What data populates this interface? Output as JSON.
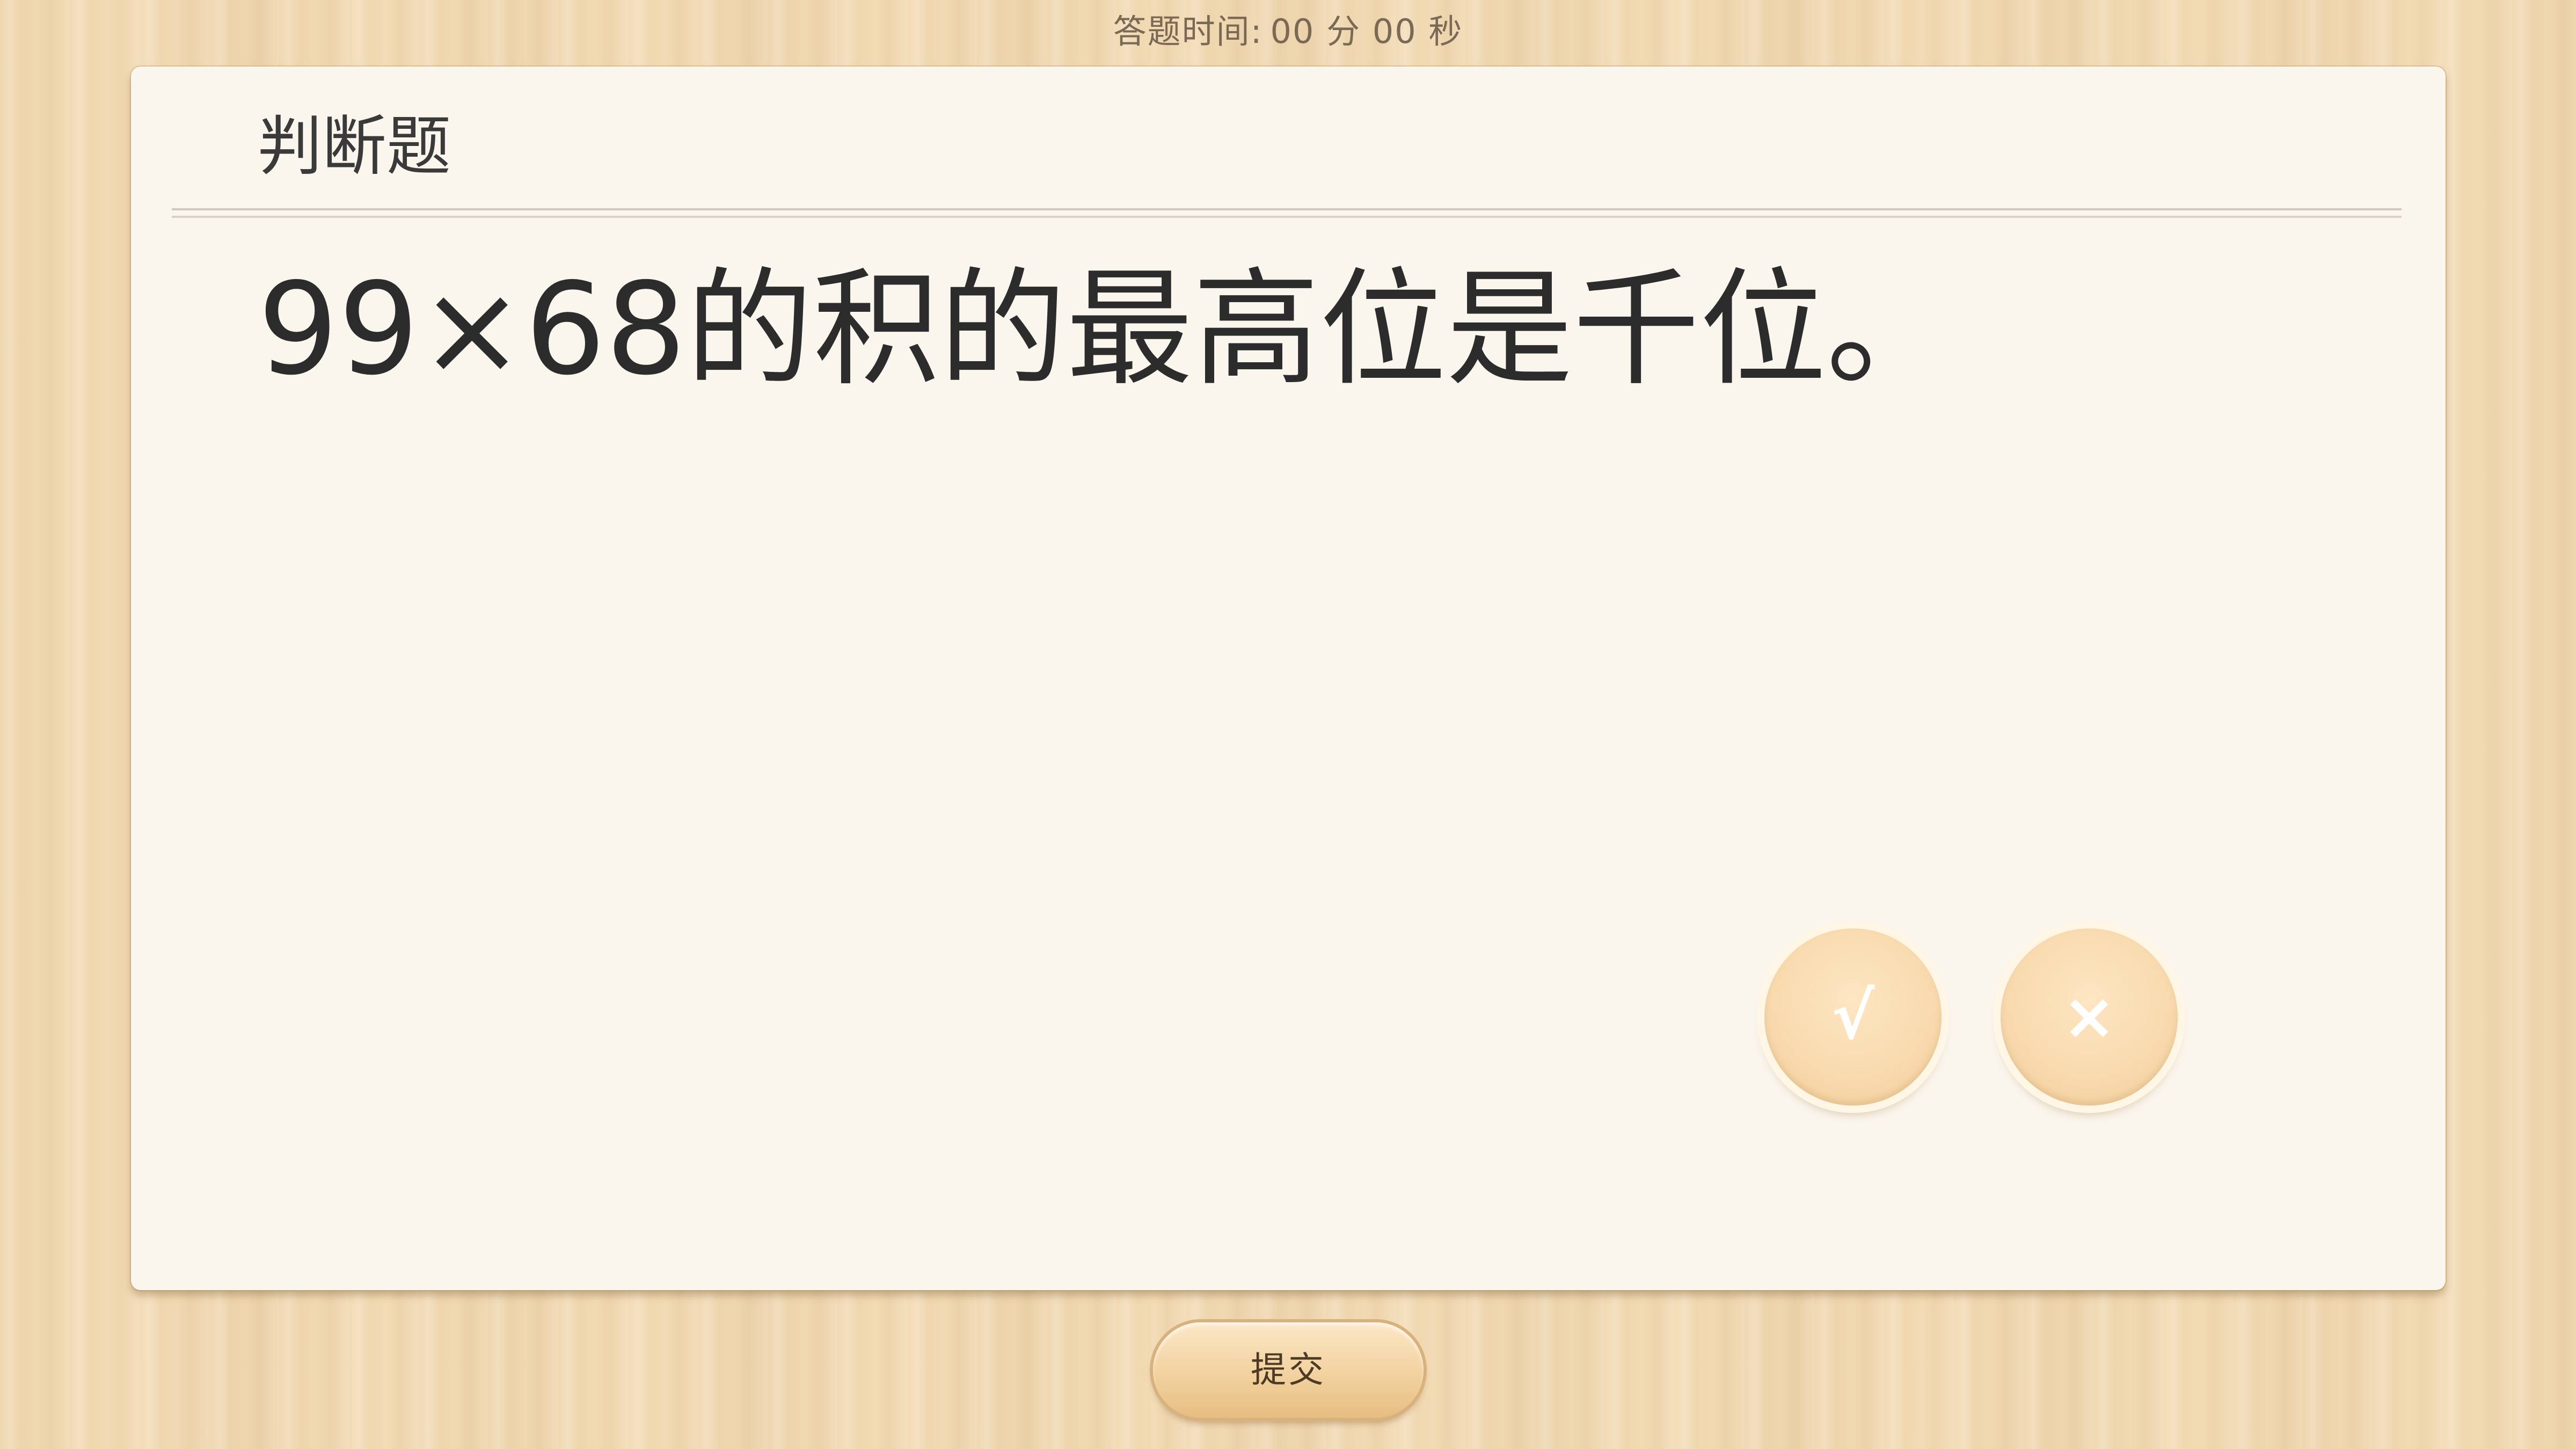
{
  "timer": {
    "label": "答题时间:",
    "value": "00 分 00 秒"
  },
  "card": {
    "title": "判断题",
    "question": "99×68的积的最高位是千位。"
  },
  "answers": {
    "true_label": "√",
    "false_label": "×"
  },
  "submit": {
    "label": "提交"
  },
  "colors": {
    "background": "#f3dcb6",
    "card": "#faf5ed",
    "answer_button": "#f8d9ad",
    "text": "#2c2c2c"
  }
}
